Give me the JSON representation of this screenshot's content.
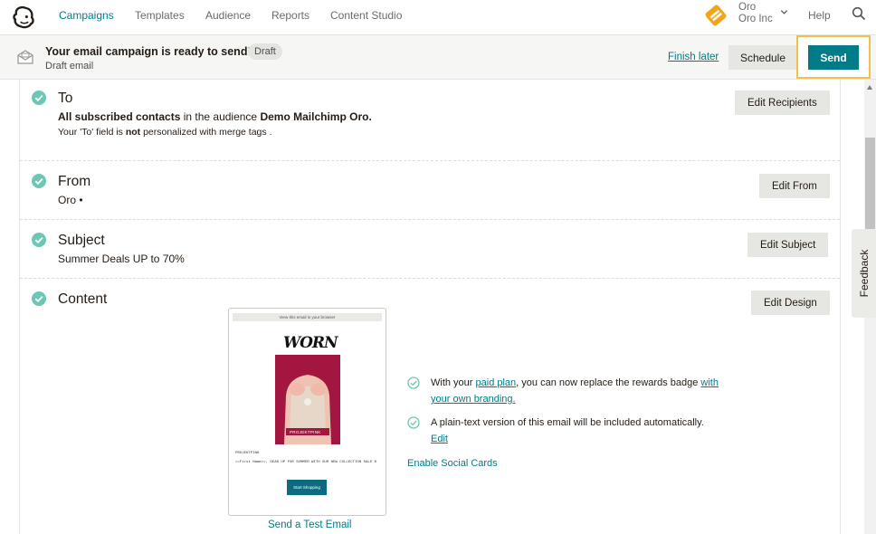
{
  "nav": {
    "items": [
      "Campaigns",
      "Templates",
      "Audience",
      "Reports",
      "Content Studio"
    ],
    "account_name": "Oro",
    "account_org": "Oro Inc",
    "help": "Help"
  },
  "status": {
    "title": "Your email campaign is ready to send!",
    "badge": "Draft",
    "subtitle": "Draft email",
    "finish_later": "Finish later",
    "schedule": "Schedule",
    "send": "Send"
  },
  "sections": {
    "to": {
      "title": "To",
      "line1_bold1": "All subscribed contacts",
      "line1_mid": " in the audience ",
      "line1_bold2": "Demo Mailchimp Oro.",
      "line2_pre": "Your 'To' field is ",
      "line2_bold": "not",
      "line2_post": " personalized with merge tags .",
      "button": "Edit Recipients"
    },
    "from": {
      "title": "From",
      "value": "Oro •",
      "button": "Edit From"
    },
    "subject": {
      "title": "Subject",
      "value": "Summer Deals UP to 70%",
      "button": "Edit Subject"
    },
    "content": {
      "title": "Content",
      "button": "Edit Design",
      "preview": {
        "top_link": "View this email in your browser",
        "logo": "WORN",
        "brand_caption": "PROJEKTPINK",
        "body_label": "PROJEKTPINK",
        "body_text": "<<First Name>>, GEAR UP FOR SUMMER WITH OUR NEW COLLECTION SALE 0",
        "cta": "Start Shopping"
      },
      "test_email": "Send a Test Email",
      "info1_pre": "With your ",
      "info1_link1": "paid plan",
      "info1_mid": ", you can now replace the rewards badge ",
      "info1_link2a": "with",
      "info1_link2b": "your own branding.",
      "info2_text": "A plain-text version of this email will be included automatically.",
      "info2_link": "Edit",
      "social": "Enable Social Cards"
    }
  },
  "feedback": "Feedback",
  "colors": {
    "accent": "#007c89",
    "check": "#6cc7b4",
    "highlight": "#f2c14a"
  }
}
